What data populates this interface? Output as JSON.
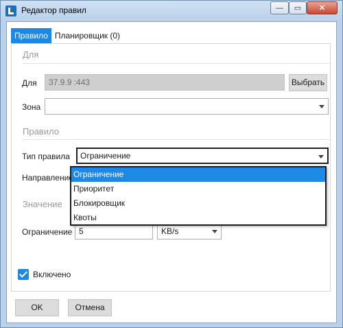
{
  "window": {
    "title": "Редактор правил",
    "controls": {
      "minimize": "—",
      "maximize": "▭",
      "close": "✕"
    }
  },
  "tabs": [
    {
      "label": "Правило",
      "active": true
    },
    {
      "label": "Планировщик (0)",
      "active": false
    }
  ],
  "for_section": {
    "header": "Для",
    "for_label": "Для",
    "for_value": "37.9.9      :443",
    "select_button": "Выбрать",
    "zone_label": "Зона",
    "zone_value": ""
  },
  "rule_section": {
    "header": "Правило",
    "type_label": "Тип правила",
    "type_value": "Ограничение",
    "direction_label": "Направление",
    "dropdown_options": [
      "Ограничение",
      "Приоритет",
      "Блокировщик",
      "Квоты"
    ],
    "selected_option": "Ограничение"
  },
  "value_section": {
    "header": "Значение",
    "limit_label": "Ограничение",
    "limit_value": "5",
    "unit_value": "KB/s"
  },
  "enabled": {
    "label": "Включено",
    "checked": true
  },
  "footer": {
    "ok": "OK",
    "cancel": "Отмена"
  },
  "colors": {
    "accent": "#1e88e5",
    "disabled_field": "#cfcfcf"
  }
}
